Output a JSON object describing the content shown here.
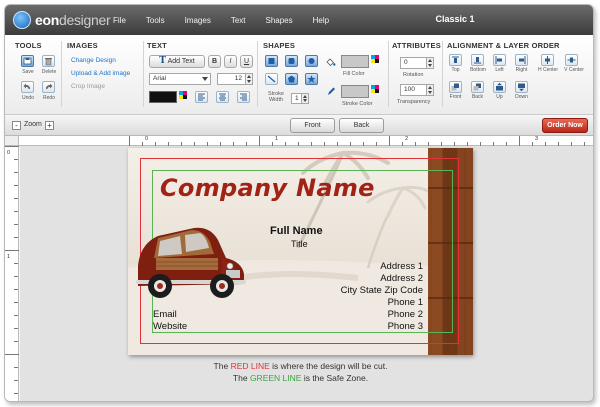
{
  "app": {
    "logo_bold": "eon",
    "logo_light": "designer",
    "document_title": "Classic 1"
  },
  "menu": [
    "File",
    "Tools",
    "Images",
    "Text",
    "Shapes",
    "Help"
  ],
  "toolbar": {
    "tools": {
      "title": "TOOLS",
      "save": "Save",
      "delete": "Delete",
      "undo": "Undo",
      "redo": "Redo"
    },
    "images": {
      "title": "IMAGES",
      "change_design": "Change Design",
      "upload": "Upload & Add image",
      "crop": "Crop Image"
    },
    "text": {
      "title": "TEXT",
      "add_text": "Add Text",
      "bold": "B",
      "italic": "I",
      "underline": "U",
      "font": "Arial",
      "size": "12"
    },
    "shapes": {
      "title": "SHAPES",
      "stroke_width_label": "Stroke Width",
      "stroke_width_value": "1",
      "fill_color_label": "Fill Color",
      "stroke_color_label": "Stroke Color"
    },
    "attributes": {
      "title": "ATTRIBUTES",
      "rotation_value": "0",
      "rotation_label": "Rotation",
      "transparency_value": "100",
      "transparency_label": "Transparency"
    },
    "alignment": {
      "title": "ALIGNMENT & LAYER ORDER",
      "row1": [
        "Top",
        "Bottom",
        "Left",
        "Right",
        "H Center",
        "V Center"
      ],
      "row2": [
        "Front",
        "Back",
        "Up",
        "Down"
      ]
    }
  },
  "zoombar": {
    "minus": "-",
    "plus": "+",
    "zoom_label": "Zoom",
    "front": "Front",
    "back": "Back",
    "order": "Order Now"
  },
  "rulers": {
    "top": [
      "0",
      "1",
      "2",
      "3"
    ],
    "left": [
      "0",
      "1"
    ]
  },
  "card": {
    "company": "Company Name",
    "full_name": "Full Name",
    "title": "Title",
    "right_lines": [
      "Address 1",
      "Address 2",
      "City State Zip Code",
      "Phone 1",
      "Phone 2",
      "Phone 3"
    ],
    "email": "Email",
    "website": "Website"
  },
  "caption": {
    "line1_pre": "The",
    "line1_color": "RED LINE",
    "line1_post": "is where the design will be cut.",
    "line2_pre": "The",
    "line2_color": "GREEN LINE",
    "line2_post": "is the Safe Zone."
  },
  "colors": {
    "accent_red": "#e0323a",
    "accent_green": "#57b457",
    "company_red": "#a12316",
    "order_button": "#c63a28"
  }
}
